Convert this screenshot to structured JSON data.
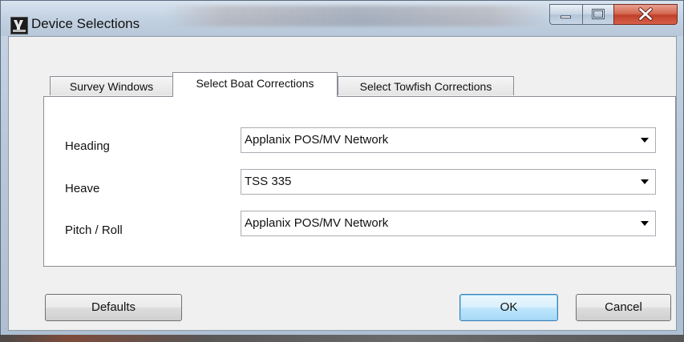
{
  "window": {
    "title": "Device Selections"
  },
  "tabs": [
    {
      "label": "Survey Windows",
      "selected": false
    },
    {
      "label": "Select Boat Corrections",
      "selected": true
    },
    {
      "label": "Select Towfish Corrections",
      "selected": false
    }
  ],
  "fields": [
    {
      "label": "Heading",
      "value": "Applanix POS/MV Network"
    },
    {
      "label": "Heave",
      "value": "TSS 335"
    },
    {
      "label": "Pitch / Roll",
      "value": "Applanix POS/MV Network"
    }
  ],
  "buttons": {
    "defaults": "Defaults",
    "ok": "OK",
    "cancel": "Cancel"
  },
  "icons": {
    "app": "app-icon",
    "minimize": "minimize-icon",
    "maximize": "maximize-icon",
    "close": "close-icon",
    "dropdown": "chevron-down-icon"
  },
  "colors": {
    "ok_border": "#3c7fb1",
    "close_button": "#c0402a",
    "panel": "#ffffff"
  }
}
